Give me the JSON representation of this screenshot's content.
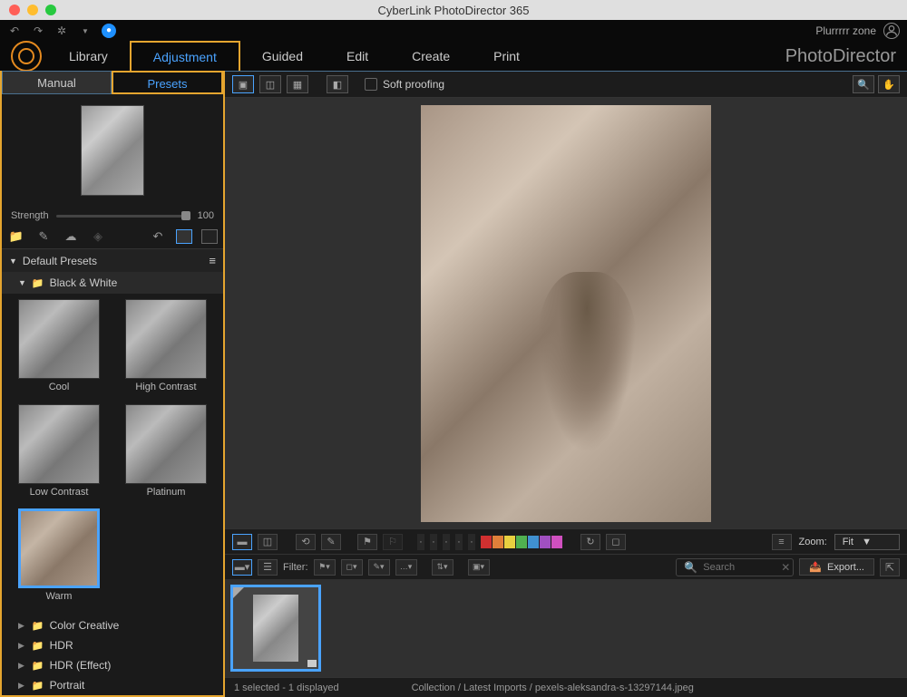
{
  "titlebar": {
    "title": "CyberLink PhotoDirector 365"
  },
  "toolbar": {
    "user": "Plurrrrr zone"
  },
  "brand": "PhotoDirector",
  "main_tabs": [
    "Library",
    "Adjustment",
    "Guided",
    "Edit",
    "Create",
    "Print"
  ],
  "main_tab_active": 1,
  "sub_tabs": [
    "Manual",
    "Presets"
  ],
  "sub_tab_active": 1,
  "strength": {
    "label": "Strength",
    "value": "100"
  },
  "presets_header": "Default Presets",
  "category_open": "Black & White",
  "presets": [
    {
      "name": "Cool"
    },
    {
      "name": "High Contrast"
    },
    {
      "name": "Low Contrast"
    },
    {
      "name": "Platinum"
    },
    {
      "name": "Warm",
      "selected": true
    }
  ],
  "categories": [
    "Color Creative",
    "HDR",
    "HDR (Effect)",
    "Portrait"
  ],
  "viewer_toolbar": {
    "soft_proofing": "Soft proofing"
  },
  "swatch_colors": [
    "#d03030",
    "#e0803a",
    "#e8d040",
    "#50b050",
    "#4090d0",
    "#a050c0",
    "#d050c0"
  ],
  "zoom": {
    "label": "Zoom:",
    "value": "Fit"
  },
  "filter_label": "Filter:",
  "search": {
    "placeholder": "Search"
  },
  "export_label": "Export...",
  "status": {
    "selection": "1 selected - 1 displayed",
    "path": "Collection / Latest Imports / pexels-aleksandra-s-13297144.jpeg"
  }
}
